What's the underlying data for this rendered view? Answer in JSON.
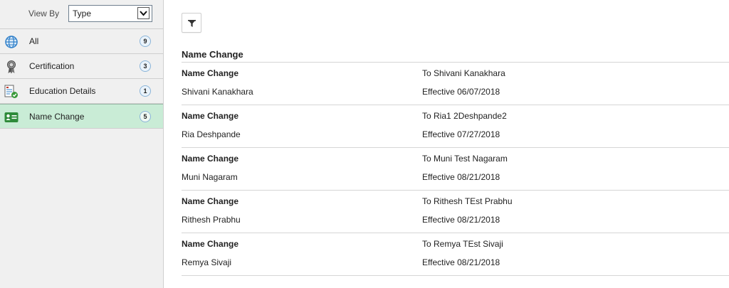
{
  "sidebar": {
    "view_by_label": "View By",
    "view_by_value": "Type",
    "items": [
      {
        "label": "All",
        "count": "9",
        "icon": "globe-icon"
      },
      {
        "label": "Certification",
        "count": "3",
        "icon": "certificate-award-icon"
      },
      {
        "label": "Education Details",
        "count": "1",
        "icon": "document-check-icon"
      },
      {
        "label": "Name Change",
        "count": "5",
        "icon": "id-card-icon"
      }
    ],
    "selected_index": 3
  },
  "main": {
    "filter_icon": "filter-funnel-icon",
    "section_title": "Name Change",
    "rows": [
      {
        "type": "Name Change",
        "person": "Shivani Kanakhara",
        "detail": "To Shivani Kanakhara",
        "effective": "Effective 06/07/2018"
      },
      {
        "type": "Name Change",
        "person": "Ria Deshpande",
        "detail": "To Ria1 2Deshpande2",
        "effective": "Effective 07/27/2018"
      },
      {
        "type": "Name Change",
        "person": "Muni Nagaram",
        "detail": "To Muni Test Nagaram",
        "effective": "Effective 08/21/2018"
      },
      {
        "type": "Name Change",
        "person": "Rithesh Prabhu",
        "detail": "To Rithesh TEst Prabhu",
        "effective": "Effective 08/21/2018"
      },
      {
        "type": "Name Change",
        "person": "Remya Sivaji",
        "detail": "To Remya TEst Sivaji",
        "effective": "Effective 08/21/2018"
      }
    ]
  },
  "colors": {
    "selected_bg": "#c9ecd6",
    "sidebar_bg": "#f0f0f0",
    "badge_border": "#8ab4d8",
    "globe_blue": "#2f7fc9",
    "check_green": "#3a9a3a"
  }
}
